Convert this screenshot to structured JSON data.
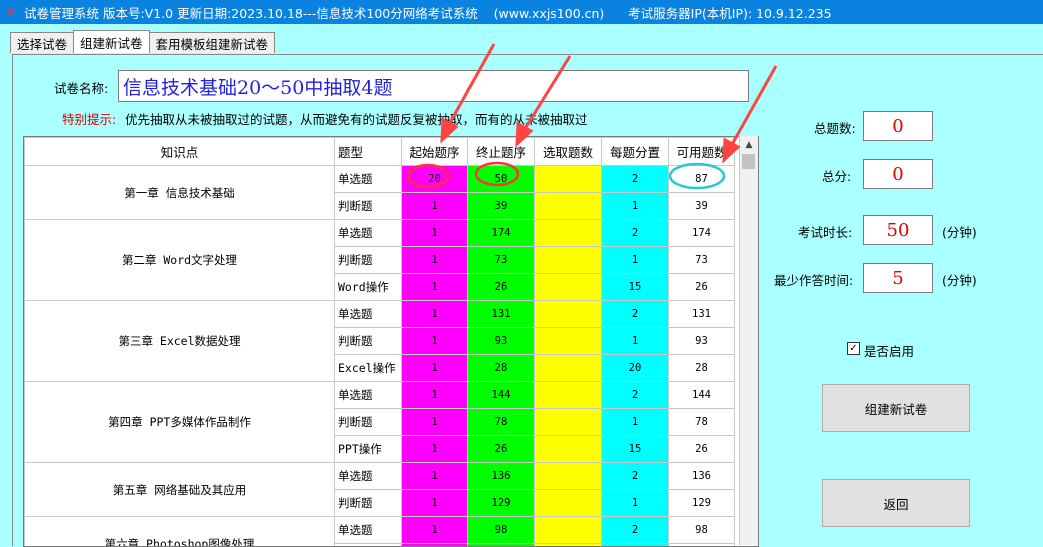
{
  "window": {
    "title": "试卷管理系统 版本号:V1.0 更新日期:2023.10.18---信息技术100分网络考试系统    (www.xxjs100.cn)      考试服务器IP(本机IP): 10.9.12.235"
  },
  "tabs": [
    "选择试卷",
    "组建新试卷",
    "套用模板组建新试卷"
  ],
  "form": {
    "name_label": "试卷名称:",
    "name_value": "信息技术基础20～50中抽取4题",
    "hint_label": "特别提示:",
    "hint_text": "优先抽取从未被抽取过的试题，从而避免有的试题反复被抽取，而有的从未被抽取过"
  },
  "table": {
    "headers": [
      "知识点",
      "题型",
      "起始题序",
      "终止题序",
      "选取题数",
      "每题分置",
      "可用题数"
    ],
    "groups": [
      {
        "chapter": "第一章 信息技术基础",
        "rows": [
          [
            "单选题",
            "20",
            "50",
            "",
            "2",
            "87"
          ],
          [
            "判断题",
            "1",
            "39",
            "",
            "1",
            "39"
          ]
        ]
      },
      {
        "chapter": "第二章 Word文字处理",
        "rows": [
          [
            "单选题",
            "1",
            "174",
            "",
            "2",
            "174"
          ],
          [
            "判断题",
            "1",
            "73",
            "",
            "1",
            "73"
          ],
          [
            "Word操作",
            "1",
            "26",
            "",
            "15",
            "26"
          ]
        ]
      },
      {
        "chapter": "第三章 Excel数据处理",
        "rows": [
          [
            "单选题",
            "1",
            "131",
            "",
            "2",
            "131"
          ],
          [
            "判断题",
            "1",
            "93",
            "",
            "1",
            "93"
          ],
          [
            "Excel操作",
            "1",
            "28",
            "",
            "20",
            "28"
          ]
        ]
      },
      {
        "chapter": "第四章 PPT多媒体作品制作",
        "rows": [
          [
            "单选题",
            "1",
            "144",
            "",
            "2",
            "144"
          ],
          [
            "判断题",
            "1",
            "78",
            "",
            "1",
            "78"
          ],
          [
            "PPT操作",
            "1",
            "26",
            "",
            "15",
            "26"
          ]
        ]
      },
      {
        "chapter": "第五章 网络基础及其应用",
        "rows": [
          [
            "单选题",
            "1",
            "136",
            "",
            "2",
            "136"
          ],
          [
            "判断题",
            "1",
            "129",
            "",
            "1",
            "129"
          ]
        ]
      },
      {
        "chapter": "第六章 Photoshop图像处理",
        "rows": [
          [
            "单选题",
            "1",
            "98",
            "",
            "2",
            "98"
          ],
          [
            "",
            "",
            "",
            "",
            "",
            ""
          ]
        ]
      }
    ]
  },
  "side": {
    "total_count_label": "总题数:",
    "total_count": "0",
    "total_score_label": "总分:",
    "total_score": "0",
    "duration_label": "考试时长:",
    "duration": "50",
    "duration_unit": "(分钟)",
    "min_time_label": "最少作答时间:",
    "min_time": "5",
    "min_time_unit": "(分钟)",
    "enable_label": "是否启用",
    "enable_checked": "✓",
    "build_button": "组建新试卷",
    "back_button": "返回"
  },
  "colors": {
    "start_col": "#ff00ff",
    "end_col": "#00ff00",
    "select_col": "#ffff00",
    "score_col": "#00ffff",
    "titlebar": "#0a83e0",
    "background": "#aaffff"
  }
}
